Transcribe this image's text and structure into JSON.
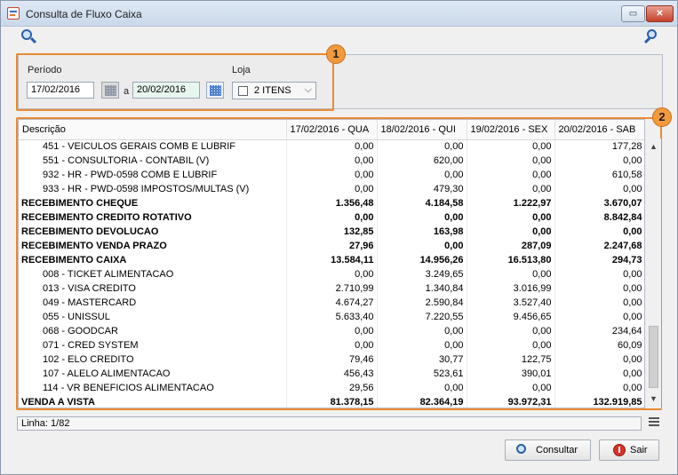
{
  "window": {
    "title": "Consulta de Fluxo Caixa",
    "restore_glyph": "▭",
    "close_glyph": "✕"
  },
  "filters": {
    "periodo_label": "Período",
    "date_from": "17/02/2016",
    "a_label": "a",
    "date_to": "20/02/2016",
    "loja_label": "Loja",
    "loja_value": "2 ITENS",
    "loja_arrow": "⌵"
  },
  "badges": {
    "filters": "1",
    "table": "2"
  },
  "table": {
    "headers": [
      "Descrição",
      "17/02/2016 - QUA",
      "18/02/2016 - QUI",
      "19/02/2016 - SEX",
      "20/02/2016 - SAB"
    ],
    "rows": [
      {
        "desc": "451 - VEICULOS GERAIS COMB E LUBRIF",
        "values": [
          "0,00",
          "0,00",
          "0,00",
          "177,28"
        ],
        "style": "sub"
      },
      {
        "desc": "551 - CONSULTORIA - CONTABIL (V)",
        "values": [
          "0,00",
          "620,00",
          "0,00",
          "0,00"
        ],
        "style": "sub"
      },
      {
        "desc": "932 - HR - PWD-0598 COMB E LUBRIF",
        "values": [
          "0,00",
          "0,00",
          "0,00",
          "610,58"
        ],
        "style": "sub"
      },
      {
        "desc": "933 - HR - PWD-0598 IMPOSTOS/MULTAS (V)",
        "values": [
          "0,00",
          "479,30",
          "0,00",
          "0,00"
        ],
        "style": "sub"
      },
      {
        "desc": "RECEBIMENTO CHEQUE",
        "values": [
          "1.356,48",
          "4.184,58",
          "1.222,97",
          "3.670,07"
        ],
        "style": "bold"
      },
      {
        "desc": "RECEBIMENTO CREDITO ROTATIVO",
        "values": [
          "0,00",
          "0,00",
          "0,00",
          "8.842,84"
        ],
        "style": "bold"
      },
      {
        "desc": "RECEBIMENTO DEVOLUCAO",
        "values": [
          "132,85",
          "163,98",
          "0,00",
          "0,00"
        ],
        "style": "bold"
      },
      {
        "desc": "RECEBIMENTO VENDA PRAZO",
        "values": [
          "27,96",
          "0,00",
          "287,09",
          "2.247,68"
        ],
        "style": "bold"
      },
      {
        "desc": "RECEBIMENTO CAIXA",
        "values": [
          "13.584,11",
          "14.956,26",
          "16.513,80",
          "294,73"
        ],
        "style": "bold"
      },
      {
        "desc": "008 - TICKET ALIMENTACAO",
        "values": [
          "0,00",
          "3.249,65",
          "0,00",
          "0,00"
        ],
        "style": "sub"
      },
      {
        "desc": "013 - VISA CREDITO",
        "values": [
          "2.710,99",
          "1.340,84",
          "3.016,99",
          "0,00"
        ],
        "style": "sub"
      },
      {
        "desc": "049 - MASTERCARD",
        "values": [
          "4.674,27",
          "2.590,84",
          "3.527,40",
          "0,00"
        ],
        "style": "sub"
      },
      {
        "desc": "055 - UNISSUL",
        "values": [
          "5.633,40",
          "7.220,55",
          "9.456,65",
          "0,00"
        ],
        "style": "sub"
      },
      {
        "desc": "068 - GOODCAR",
        "values": [
          "0,00",
          "0,00",
          "0,00",
          "234,64"
        ],
        "style": "sub"
      },
      {
        "desc": "071 - CRED SYSTEM",
        "values": [
          "0,00",
          "0,00",
          "0,00",
          "60,09"
        ],
        "style": "sub"
      },
      {
        "desc": "102 - ELO CREDITO",
        "values": [
          "79,46",
          "30,77",
          "122,75",
          "0,00"
        ],
        "style": "sub"
      },
      {
        "desc": "107 - ALELO ALIMENTACAO",
        "values": [
          "456,43",
          "523,61",
          "390,01",
          "0,00"
        ],
        "style": "sub"
      },
      {
        "desc": "114 - VR BENEFICIOS ALIMENTACAO",
        "values": [
          "29,56",
          "0,00",
          "0,00",
          "0,00"
        ],
        "style": "sub"
      },
      {
        "desc": "VENDA A VISTA",
        "values": [
          "81.378,15",
          "82.364,19",
          "93.972,31",
          "132.919,85"
        ],
        "style": "bold"
      }
    ]
  },
  "scroll": {
    "up_glyph": "▲",
    "down_glyph": "▼"
  },
  "status": {
    "linha": "Linha: 1/82"
  },
  "buttons": {
    "consultar": "Consultar",
    "sair": "Sair"
  }
}
